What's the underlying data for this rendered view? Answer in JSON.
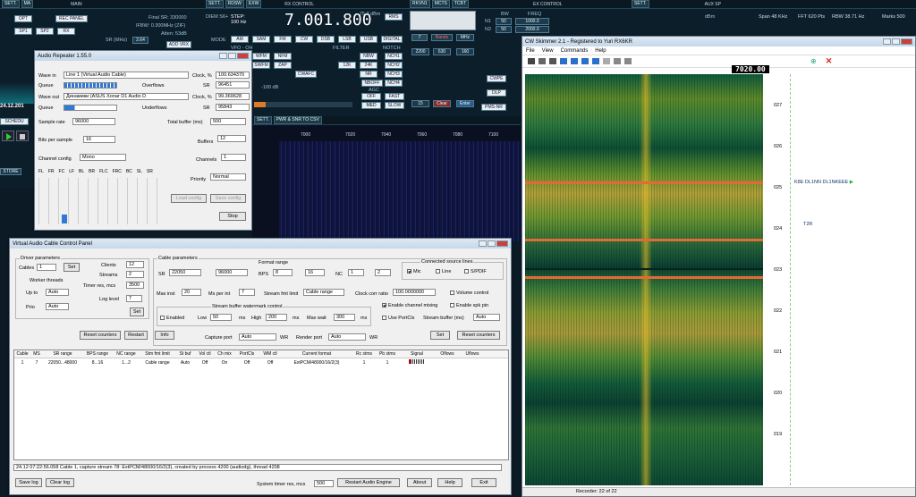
{
  "sdr_main": {
    "title": "MAIN",
    "sett": "SETT.",
    "ma": "MA",
    "opt": "OPT",
    "rec": "REC PANEL",
    "final_sr": "Final SR: 330000",
    "ifbw": "IFBW: 0.300MHz (ZIF)",
    "atten": "Atten: 53dB",
    "sr_label": "SR (MHz)",
    "sr_val": "2.64",
    "ant": "ADD VRX",
    "sp1": "SP1",
    "sp2": "SP2",
    "rx": "RX",
    "sched": "SCHEDU",
    "date": "24.12.201",
    "store": "STORE"
  },
  "sdr_rx": {
    "sett": "SETT.",
    "rdsw": "RDSW",
    "exw": "EXW",
    "title": "RX CONTROL",
    "freq": "7.001.800",
    "dbm": "-75.2 dBm",
    "rms": "RMS",
    "step": "STEP: 100 Hz",
    "diem": "DIEM S6+",
    "mode_lbl": "MODE",
    "modes": [
      "AM",
      "SAM",
      "FM",
      "CW",
      "DSB",
      "LSB",
      "USB",
      "DIGITAL"
    ],
    "filter_lbl": "FILTER",
    "notch_lbl": "NOTCH",
    "vfo": "VFO - OH",
    "wfm": "WFM",
    "nfm": "NFM",
    "swfm": "SWFM",
    "zap": "ZAP",
    "nbw": "NBW",
    "nchs": [
      "NCH1",
      "NCH2",
      "NCH3",
      "NCH4"
    ],
    "k12": "12K",
    "k24": "24K",
    "nr": "NR",
    "nboff": "NBOFF",
    "cwafc": "CWAFC",
    "agc_lbl": "AGC",
    "off": "OFF",
    "fast": "FAST",
    "med": "MED",
    "slow": "SLOW",
    "db": "-100 dB",
    "keys": [
      "7",
      "8",
      "9",
      "4",
      "5",
      "6",
      "1",
      "2",
      "3",
      "0",
      "15"
    ],
    "bands": "Bands",
    "mhz": "MHz",
    "f2200": "2200",
    "f630": "630",
    "f160": "160",
    "clear": "Clear",
    "enter": "Enter",
    "rkvn": "RKVN1",
    "mcts": "MCTS",
    "tcbt": "TCBT"
  },
  "sdr_ex": {
    "title": "EX CONTROL",
    "bw": "BW",
    "freq": "FREQ",
    "n1": "N1",
    "n2": "N2",
    "n1bw": "50",
    "n1f": "1000.0",
    "n2bw": "50",
    "n2f": "2000.0",
    "cwpe": "CWPE",
    "agc": "AGC",
    "dlp": "DLP",
    "apc": "APC",
    "pmsnr": "PMS-NR",
    "f500": "500",
    "f510": "510"
  },
  "sdr_aux": {
    "title": "AUX SP",
    "sett": "SETT.",
    "span": "Span 48 KHz",
    "fft": "FFT 620 Pts",
    "rbw": "RBW 38.71 Hz",
    "marks": "Marks 500",
    "dbm": "dBm",
    "pwr": "PWR & SNR TO CSV",
    "sett2": "SETT.",
    "freqs": [
      "7000",
      "7020",
      "7040",
      "7060",
      "7080",
      "7100"
    ]
  },
  "audio_repeater": {
    "title": "Audio Repeater 1.55.0",
    "wave_in_lbl": "Wave in",
    "wave_in": "Line 1 (Virtual Audio Cable)",
    "queue_lbl": "Queue",
    "overflows_lbl": "Overflows",
    "wave_out_lbl": "Wave out",
    "wave_out": "Динамики (ASUS Xonar D1 Audio D",
    "underflows_lbl": "Underflows",
    "clock1_lbl": "Clock, %",
    "clock1": "100.634370",
    "sr1": "96451",
    "clock2_lbl": "Clock, %",
    "clock2": "99.369628",
    "sr_lbl": "SR",
    "sr2": "95843",
    "samplerate_lbl": "Sample rate",
    "samplerate": "96000",
    "totalbuf_lbl": "Total buffer (ms)",
    "totalbuf": "500",
    "bits_lbl": "Bits per sample",
    "bits": "16",
    "buffers_lbl": "Buffers",
    "buffers": "12",
    "chcfg_lbl": "Channel config",
    "chcfg": "Mono",
    "channels_lbl": "Channels",
    "channels": "1",
    "priority_lbl": "Priority",
    "priority": "Normal",
    "ch": [
      "FL",
      "FR",
      "FC",
      "LF",
      "BL",
      "BR",
      "FLC",
      "FRC",
      "BC",
      "SL",
      "SR"
    ],
    "load": "Load config",
    "save": "Save config",
    "stop": "Stop"
  },
  "vac": {
    "title": "Virtual Audio Cable Control Panel",
    "driver_lbl": "Driver parameters",
    "cables_lbl": "Cables",
    "cables": "1",
    "set": "Set",
    "clients_lbl": "Clients",
    "clients": "12",
    "streams_lbl": "Streams",
    "streams": "2",
    "timer_lbl": "Timer res, mcs",
    "timer": "3500",
    "worker_lbl": "Worker threads",
    "upto_lbl": "Up to",
    "upto": "Auto",
    "prio_lbl": "Prio",
    "prio": "Auto",
    "loglevel_lbl": "Log level",
    "loglevel": "7",
    "set2": "Set",
    "cable_params": "Cable parameters",
    "format_range": "Format range",
    "sr_lbl": "SR",
    "sr_from": "22050",
    "sr_to": "96000",
    "bps_lbl": "BPS",
    "bps_from": "8",
    "bps_to": "16",
    "nc_lbl": "NC",
    "nc_from": "1",
    "nc_to": "2",
    "maxinst_lbl": "Max inst",
    "maxinst": "20",
    "msperint_lbl": "Ms per int",
    "msperint": "7",
    "sfl_lbl": "Stream fmt limit",
    "sfl": "Cable range",
    "ccr_lbl": "Clock corr ratio",
    "ccr": "100.0000000",
    "watermark_lbl": "Stream buffer watermark control",
    "enabled_lbl": "Enabled",
    "low_lbl": "Low",
    "low": "50",
    "ms1": "ms",
    "high_lbl": "High",
    "high": "200",
    "ms2": "ms",
    "maxwait_lbl": "Max wait",
    "maxwait": "300",
    "ms3": "ms",
    "css_lbl": "Connected source lines",
    "mic": "Mic",
    "line": "Line",
    "spdif": "S/PDIF",
    "vol": "Volume control",
    "ecm": "Enable channel mixing",
    "esp": "Enable spk pin",
    "upc": "Use PortCls",
    "sbuf_lbl": "Stream buffer (ms)",
    "sbuf": "Auto",
    "rc1": "Reset counters",
    "restart": "Restart",
    "info": "Info",
    "capport_lbl": "Capture port",
    "capport": "Auto",
    "wr1": "WR",
    "renport_lbl": "Render port",
    "renport": "Auto",
    "wr2": "WR",
    "set3": "Set",
    "rc2": "Reset counters",
    "cols": [
      "Cable",
      "MS",
      "SR range",
      "BPS range",
      "NC range",
      "Stm fmt limit",
      "St buf",
      "Vol ctl",
      "Ch mix",
      "PortCls",
      "WM ctl",
      "Current format",
      "Rc stms",
      "Pb stms",
      "Signal",
      "Oflows",
      "Uflows"
    ],
    "row": [
      "1",
      "7",
      "22050...48000",
      "8...16",
      "1...2",
      "Cable range",
      "Auto",
      "Off",
      "On",
      "Off",
      "Off",
      "ExtPCM/48000/16/2(3)",
      "1",
      "1",
      "",
      "",
      ""
    ],
    "log": "24.12 07:22:56.058 Cable 1, capture stream 78: ExtPCM/48000/16/2(3), created by process 4200 (audiodg), thread 4208",
    "savelog": "Save log",
    "clearlog": "Clear log",
    "systimer_lbl": "System timer res, mcs",
    "systimer": "500",
    "restart_eng": "Restart Audio Engine",
    "about": "About",
    "help": "Help",
    "exit": "Exit"
  },
  "skimmer": {
    "title": "CW Skimmer 2.1 - Registered to Yuri RX6KR",
    "menu": [
      "File",
      "View",
      "Commands",
      "Help"
    ],
    "freq": "7020.00",
    "scale": [
      "027",
      "026",
      "025",
      "024",
      "023",
      "022",
      "021",
      "020",
      "019"
    ],
    "spot1": "K8E DL1NN DL1NKEEE",
    "spot2": "T2R",
    "status": [
      "Recorder: 22 of 22"
    ]
  }
}
